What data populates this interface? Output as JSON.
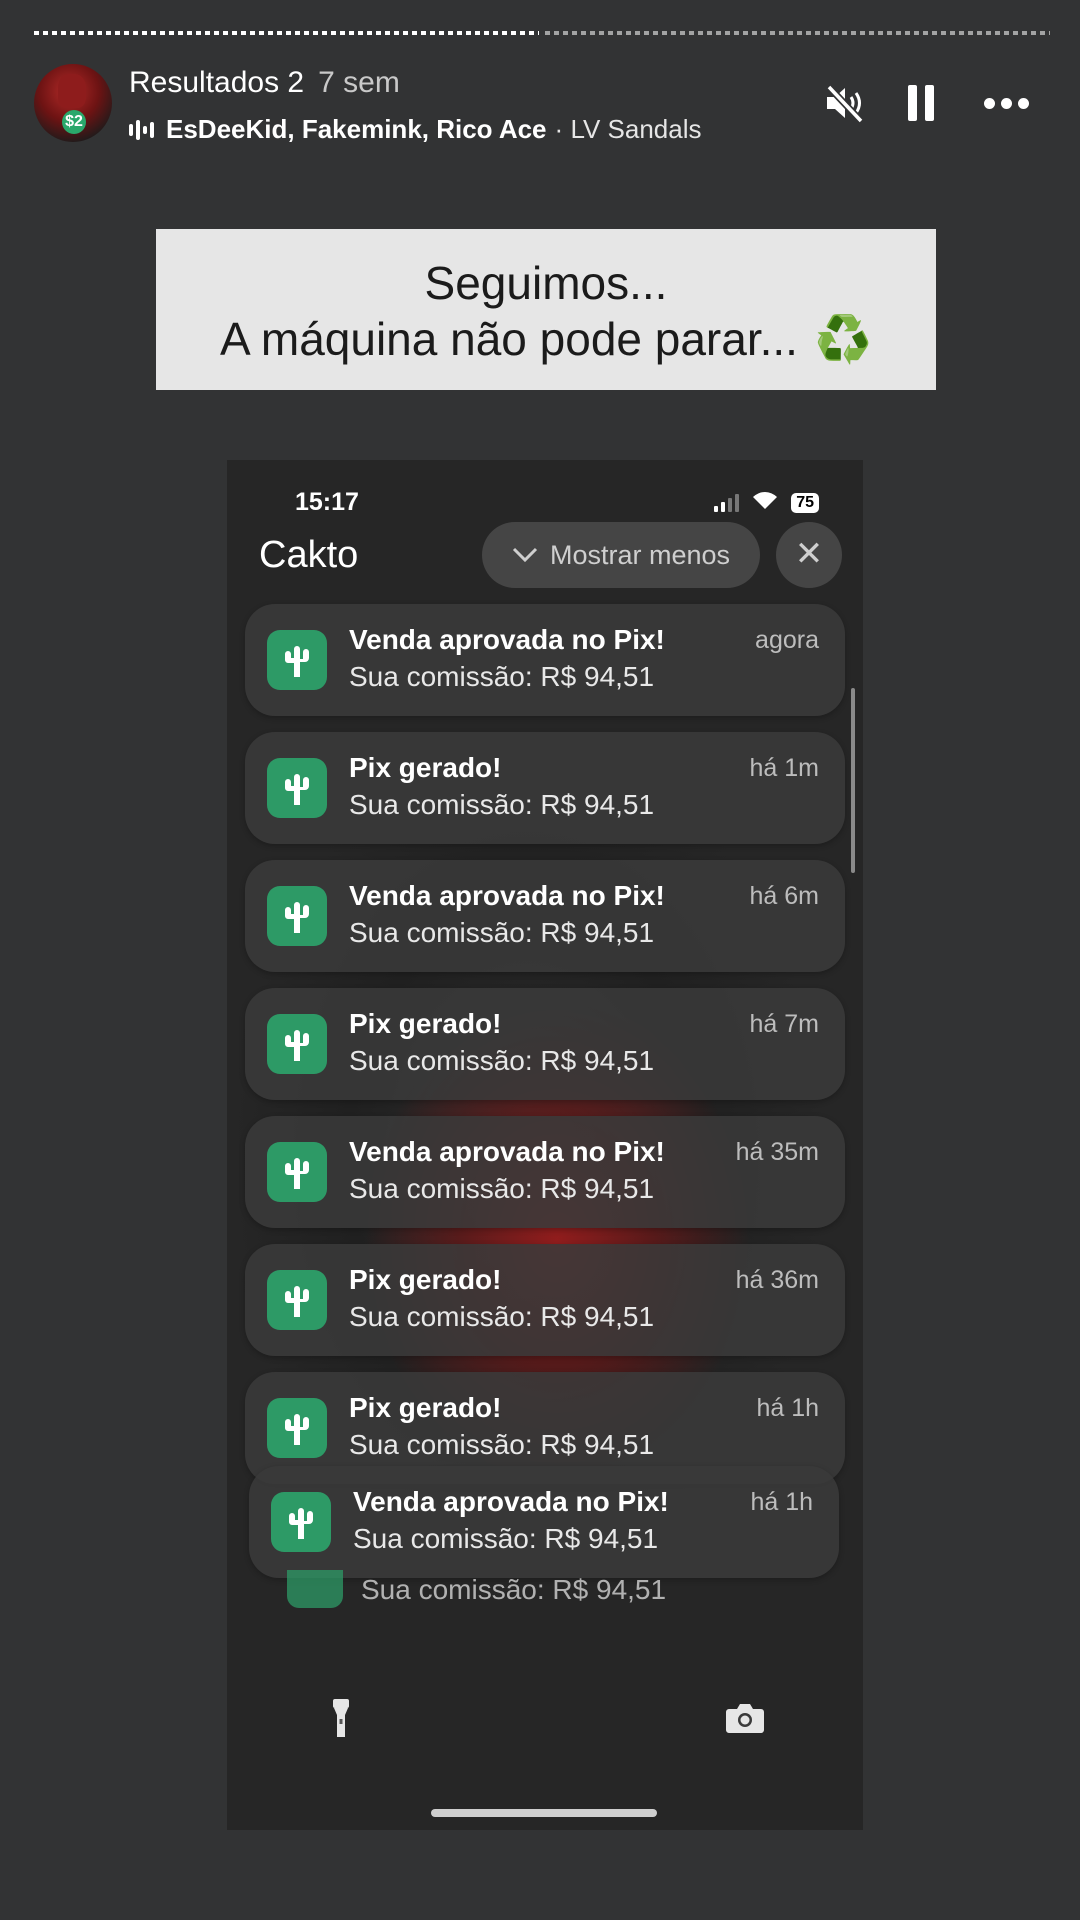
{
  "story": {
    "segments": [
      1,
      0
    ],
    "title": "Resultados 2",
    "age": "7 sem",
    "avatar_badge": "$2",
    "music": {
      "artists": "EsDeeKid, Fakemink, Rico Ace",
      "separator": "·",
      "song": "LV Sandals"
    },
    "controls": {
      "mute_icon": "speaker-muted-icon",
      "pause_icon": "pause-icon",
      "more_icon": "more-horizontal-icon"
    }
  },
  "caption": {
    "line1": "Seguimos...",
    "line2": "A máquina não pode parar...",
    "emoji": "♻️"
  },
  "phone": {
    "time": "15:17",
    "battery": "75",
    "app_name": "Cakto",
    "show_less_label": "Mostrar menos",
    "close_symbol": "✕",
    "accent_color": "#2d9a66",
    "notifications": [
      {
        "title": "Venda aprovada no Pix!",
        "body": "Sua comissão: R$ 94,51",
        "time": "agora"
      },
      {
        "title": "Pix gerado!",
        "body": "Sua comissão: R$ 94,51",
        "time": "há 1m"
      },
      {
        "title": "Venda aprovada no Pix!",
        "body": "Sua comissão: R$ 94,51",
        "time": "há 6m"
      },
      {
        "title": "Pix gerado!",
        "body": "Sua comissão: R$ 94,51",
        "time": "há 7m"
      },
      {
        "title": "Venda aprovada no Pix!",
        "body": "Sua comissão: R$ 94,51",
        "time": "há 35m"
      },
      {
        "title": "Pix gerado!",
        "body": "Sua comissão: R$ 94,51",
        "time": "há 36m"
      },
      {
        "title": "Pix gerado!",
        "body": "Sua comissão: R$ 94,51",
        "time": "há 1h"
      },
      {
        "title": "Venda aprovada no Pix!",
        "body": "Sua comissão: R$ 94,51",
        "time": "há 1h"
      }
    ],
    "stacked_preview": "Sua comissão: R$ 94,51",
    "flashlight_icon": "flashlight-icon",
    "camera_icon": "camera-icon"
  }
}
